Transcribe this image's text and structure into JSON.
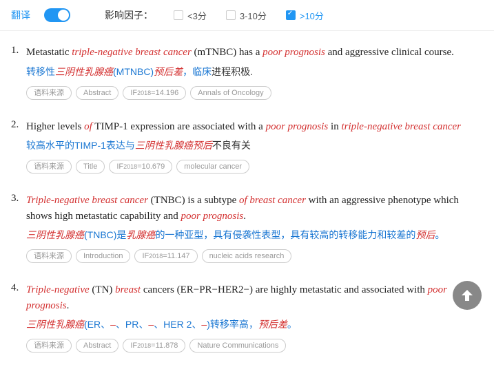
{
  "header": {
    "translate_label": "翻译",
    "factor_label": "影响因子：",
    "filters": [
      {
        "label": "<3分",
        "checked": false
      },
      {
        "label": "3-10分",
        "checked": false
      },
      {
        "label": ">10分",
        "checked": true
      }
    ]
  },
  "results": [
    {
      "num": "1.",
      "sentence_parts": [
        {
          "t": "Metastatic ",
          "hl": false
        },
        {
          "t": "triple-negative breast cancer",
          "hl": true
        },
        {
          "t": " (mTNBC) has a ",
          "hl": false
        },
        {
          "t": "poor prognosis",
          "hl": true
        },
        {
          "t": " and aggressive clinical course.",
          "hl": false
        }
      ],
      "translation_parts": [
        {
          "t": "转移性",
          "cls": "blue"
        },
        {
          "t": "三阴性乳腺癌",
          "cls": "red"
        },
        {
          "t": "(MTNBC)",
          "cls": "blue"
        },
        {
          "t": "预后差",
          "cls": "red"
        },
        {
          "t": "，临床",
          "cls": "blue"
        },
        {
          "t": "进程积极.",
          "cls": ""
        }
      ],
      "tags": [
        "语料来源",
        "Abstract",
        "IF2018=14.196",
        "Annals of Oncology"
      ]
    },
    {
      "num": "2.",
      "sentence_parts": [
        {
          "t": "Higher levels ",
          "hl": false
        },
        {
          "t": "of",
          "hl": true
        },
        {
          "t": " TIMP-1 expression are associated with a ",
          "hl": false
        },
        {
          "t": "poor prognosis",
          "hl": true
        },
        {
          "t": " in ",
          "hl": false
        },
        {
          "t": "triple-negative breast cancer",
          "hl": true
        }
      ],
      "translation_parts": [
        {
          "t": "较高水平的TIMP-1表达与",
          "cls": "blue"
        },
        {
          "t": "三阴性乳腺癌预后",
          "cls": "red"
        },
        {
          "t": "不良有关",
          "cls": ""
        }
      ],
      "tags": [
        "语料来源",
        "Title",
        "IF2018=10.679",
        "molecular cancer"
      ]
    },
    {
      "num": "3.",
      "sentence_parts": [
        {
          "t": "Triple-negative breast cancer",
          "hl": true
        },
        {
          "t": " (TNBC) is a subtype ",
          "hl": false
        },
        {
          "t": "of breast cancer",
          "hl": true
        },
        {
          "t": " with an aggressive phenotype which shows high metastatic capability and ",
          "hl": false
        },
        {
          "t": "poor prognosis",
          "hl": true
        },
        {
          "t": ".",
          "hl": false
        }
      ],
      "translation_parts": [
        {
          "t": "三阴性乳腺癌",
          "cls": "red"
        },
        {
          "t": "(TNBC)是",
          "cls": "blue"
        },
        {
          "t": "乳腺癌",
          "cls": "red"
        },
        {
          "t": "的一种亚型，具有侵袭性表型，具有较高的转移能力和较差的",
          "cls": "blue"
        },
        {
          "t": "预后",
          "cls": "red"
        },
        {
          "t": "。",
          "cls": "blue"
        }
      ],
      "tags": [
        "语料来源",
        "Introduction",
        "IF2018=11.147",
        "nucleic acids research"
      ]
    },
    {
      "num": "4.",
      "sentence_parts": [
        {
          "t": "Triple-negative",
          "hl": true
        },
        {
          "t": " (TN) ",
          "hl": false
        },
        {
          "t": "breast",
          "hl": true
        },
        {
          "t": " cancers (ER−PR−HER2−) are highly metastatic and associated with ",
          "hl": false
        },
        {
          "t": "poor prognosis",
          "hl": true
        },
        {
          "t": ".",
          "hl": false
        }
      ],
      "translation_parts": [
        {
          "t": "三阴性乳腺癌",
          "cls": "red"
        },
        {
          "t": "(ER、",
          "cls": "blue"
        },
        {
          "t": "–",
          "cls": "red"
        },
        {
          "t": "、PR、",
          "cls": "blue"
        },
        {
          "t": "–",
          "cls": "red"
        },
        {
          "t": "、HER 2、",
          "cls": "blue"
        },
        {
          "t": "–",
          "cls": "red"
        },
        {
          "t": ")转移率高，",
          "cls": "blue"
        },
        {
          "t": "预后差",
          "cls": "red"
        },
        {
          "t": "。",
          "cls": "blue"
        }
      ],
      "tags": [
        "语料来源",
        "Abstract",
        "IF2018=11.878",
        "Nature Communications"
      ]
    }
  ]
}
